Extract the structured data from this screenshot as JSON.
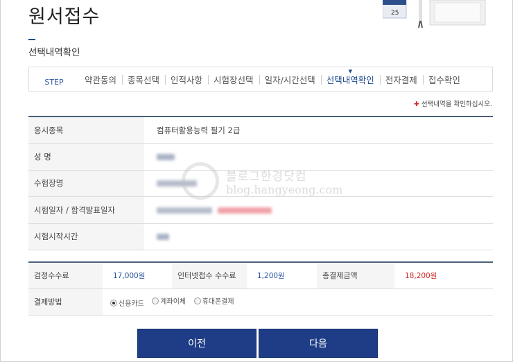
{
  "page": {
    "title": "원서접수",
    "section_title": "선택내역확인"
  },
  "steps": {
    "label": "STEP",
    "items": [
      "약관동의",
      "종목선택",
      "인적사항",
      "시험장선택",
      "일자/시간선택",
      "선택내역확인",
      "전자결제",
      "접수확인"
    ],
    "active_index": 5
  },
  "note": "선택내역을 확인하십시오.",
  "info": {
    "rows": [
      {
        "label": "응시종목",
        "value": "컴퓨터활용능력 필기 2급"
      },
      {
        "label": "성 명",
        "value": ""
      },
      {
        "label": "수험장명",
        "value": ""
      },
      {
        "label": "시험일자 / 합격발표일자",
        "value": ""
      },
      {
        "label": "시험시작시간",
        "value": ""
      }
    ]
  },
  "payment": {
    "fee_label": "검정수수료",
    "fee_value": "17,000원",
    "internet_fee_label": "인터넷접수 수수료",
    "internet_fee_value": "1,200원",
    "total_label": "총결제금액",
    "total_value": "18,200원",
    "method_label": "결제방법",
    "methods": [
      "신용카드",
      "계좌이체",
      "휴대폰결제"
    ],
    "selected_method": "신용카드"
  },
  "buttons": {
    "prev": "이전",
    "next": "다음"
  },
  "watermark": {
    "line1": "블로그한경닷컴",
    "line2": "blog.hangyeong.com"
  },
  "deco": {
    "calendar_day": "25"
  },
  "colors": {
    "primary": "#1f3d86",
    "accent_blue": "#2c56a0",
    "price_red": "#d12a2a",
    "table_header_bg": "#f5f5f5"
  }
}
